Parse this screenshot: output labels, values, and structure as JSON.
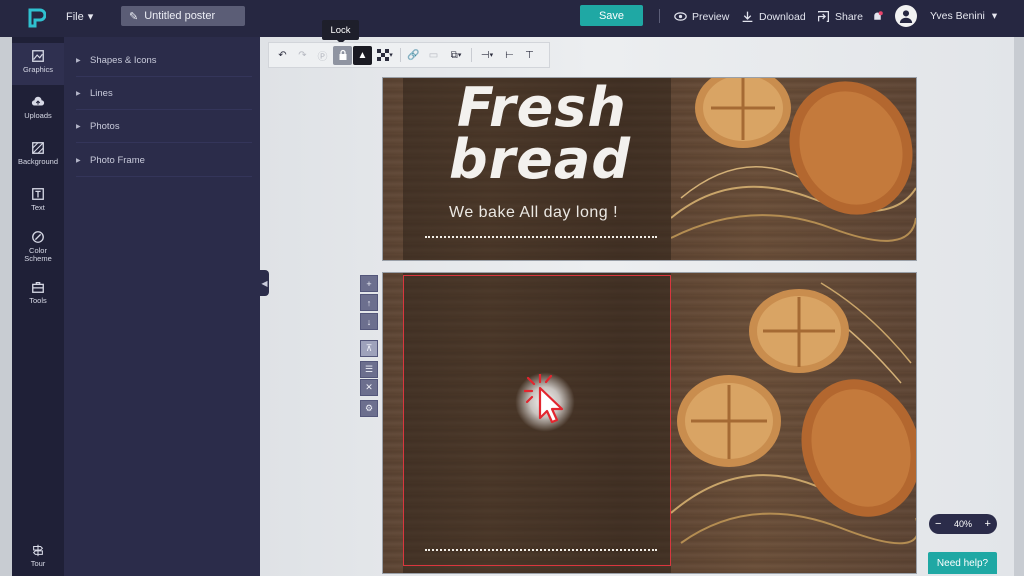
{
  "topbar": {
    "file_label": "File",
    "document_title": "Untitled poster",
    "save_label": "Save",
    "preview_label": "Preview",
    "download_label": "Download",
    "share_label": "Share",
    "user_name": "Yves Benini"
  },
  "rail": {
    "items": [
      {
        "label": "Graphics",
        "icon": "graphics-icon"
      },
      {
        "label": "Uploads",
        "icon": "cloud-upload-icon"
      },
      {
        "label": "Background",
        "icon": "background-icon"
      },
      {
        "label": "Text",
        "icon": "text-icon"
      },
      {
        "label": "Color Scheme",
        "icon": "palette-icon"
      },
      {
        "label": "Tools",
        "icon": "toolbox-icon"
      },
      {
        "label": "Tour",
        "icon": "tour-icon"
      }
    ]
  },
  "panel": {
    "rows": [
      "Shapes & Icons",
      "Lines",
      "Photos",
      "Photo Frame"
    ]
  },
  "toolbar": {
    "tooltip": "Lock"
  },
  "poster": {
    "headline_line1": "Fresh",
    "headline_line2": "bread",
    "tagline": "We bake All day long !"
  },
  "zoom": {
    "level": "40%"
  },
  "help": {
    "label": "Need help?"
  },
  "colors": {
    "topbar": "#262741",
    "accent": "#1fa8a4",
    "selection": "#d9363e"
  }
}
